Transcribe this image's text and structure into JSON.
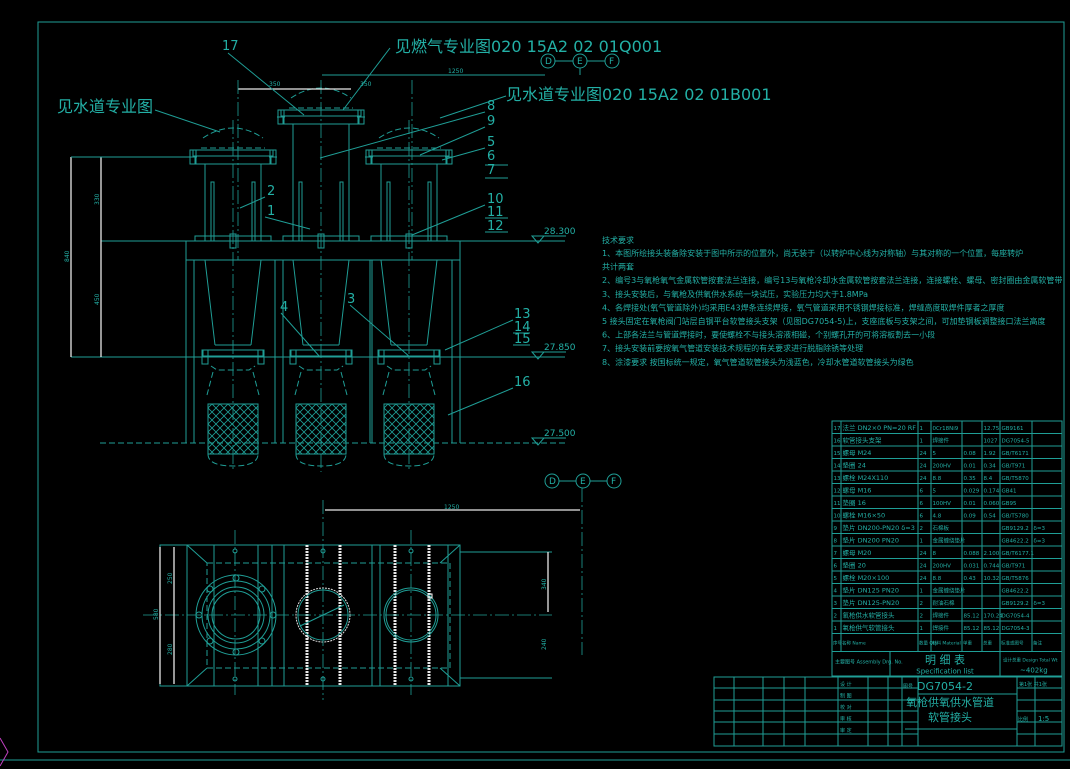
{
  "colors": {
    "line": "#1f9e96",
    "text": "#23b0a6",
    "dimension": "#e8e8e8",
    "background": "#000000"
  },
  "callouts": {
    "gas_ref": "见燃气专业图020 15A2 02 01Q001",
    "water_ref_right": "见水道专业图020 15A2 02 01B001",
    "water_ref_left": "见水道专业图",
    "parts": [
      "17",
      "8",
      "9",
      "5",
      "6",
      "7",
      "10",
      "11",
      "12",
      "2",
      "1",
      "4",
      "3",
      "13",
      "14",
      "15",
      "16"
    ]
  },
  "axes": {
    "top": [
      "D",
      "E",
      "F"
    ],
    "bottom": [
      "D",
      "E",
      "F"
    ]
  },
  "levels": [
    "28.300",
    "27.850",
    "27.500"
  ],
  "dimensions": {
    "d350a": "350",
    "d350b": "350",
    "d1250top": "1250",
    "d330": "330",
    "d840": "840",
    "d450": "450",
    "d1250plan": "1250",
    "d580": "580",
    "d250": "250",
    "d280": "280",
    "d340": "340",
    "d240": "240"
  },
  "notes": {
    "title": "技术要求",
    "items": [
      "1、本图所绘接头装备除安装于图中所示的位置外，尚无装于（以转炉中心线为对称轴）与其对称的一个位置，每座转炉",
      "    共计两套",
      "2、编号3与氧枪氧气金属软管按套法兰连接，编号13与氧枪冷却水金属软管按套法兰连接，连接螺栓、螺母、密封圈由金属软管带",
      "3、接头安装后，与氧枪及供氧供水系统一块试压，实验压力均大于1.8MPa",
      "4、各焊接处(氧气管道除外)均采用E43焊条连续焊接，氧气管道采用不锈钢焊接标准，焊缝高度取焊件厚者之厚度",
      "5  接头固定在氧枪阀门站层自钢平台软管接头支架（见图DG7054-5)上，支座底板与支架之间，可加垫钢板调整接口法兰高度",
      "6、上部各法兰与管道焊接时，要使螺栓不与接头溶液相碰，个别螺孔开的可将溶板割去一小段",
      "7、接头安装前要按氧气管道安装技术规程的有关要求进行脱脂除锈等处理",
      "8、涂漆要求  按国标统一规定，氧气管道软管接头为浅蓝色，冷却水管道软管接头为绿色"
    ]
  },
  "bom": {
    "rows": [
      [
        "17",
        "法兰 DN2×0 PN=20 RF",
        "1",
        "0Cr18Ni9",
        "",
        "12.75",
        "GB9161",
        ""
      ],
      [
        "16",
        "软管接头支架",
        "1",
        "焊接件",
        "",
        "1027",
        "DG7054-5",
        ""
      ],
      [
        "15",
        "螺母 M24",
        "24",
        "5",
        "0.08",
        "1.92",
        "GB/T6171",
        ""
      ],
      [
        "14",
        "垫圈 24",
        "24",
        "200HV",
        "0.01",
        "0.34",
        "GB/T971",
        ""
      ],
      [
        "13",
        "螺栓 M24X110",
        "24",
        "8.8",
        "0.35",
        "8.4",
        "GB/T5870",
        ""
      ],
      [
        "12",
        "螺母 M16",
        "6",
        "5",
        "0.029",
        "0.174",
        "GB41",
        ""
      ],
      [
        "11",
        "垫圈 16",
        "6",
        "100HV",
        "0.01",
        "0.060",
        "GB95",
        ""
      ],
      [
        "10",
        "螺栓 M16×50",
        "6",
        "4.8",
        "0.09",
        "0.54",
        "GB/T5780",
        ""
      ],
      [
        "9",
        "垫片 DN200-PN20 δ=3",
        "2",
        "石棉板",
        "",
        "",
        "GB9129.2",
        "δ=3"
      ],
      [
        "8",
        "垫片 DN200 PN20",
        "1",
        "金属缠绕垫片",
        "",
        "",
        "GB4622.2",
        "δ=3"
      ],
      [
        "7",
        "螺母 M20",
        "24",
        "8",
        "0.088",
        "2.100",
        "GB/T6177.1",
        ""
      ],
      [
        "6",
        "垫圈 20",
        "24",
        "200HV",
        "0.031",
        "0.744",
        "GB/T971",
        ""
      ],
      [
        "5",
        "螺栓 M20×100",
        "24",
        "8.8",
        "0.43",
        "10.32",
        "GB/T5876",
        ""
      ],
      [
        "4",
        "垫片 DN125 PN20",
        "1",
        "金属缠绕垫片",
        "",
        "",
        "GB4622.2",
        ""
      ],
      [
        "3",
        "垫片 DN125-PN20",
        "2",
        "耐油石棉",
        "",
        "",
        "GB9129.2",
        "δ=3"
      ],
      [
        "2",
        "氧枪供水软管接头",
        "2",
        "焊接件",
        "85.12",
        "170.24",
        "DG7054-4",
        ""
      ],
      [
        "1",
        "氧枪供气软管接头",
        "1",
        "焊接件",
        "85.12",
        "85.12",
        "DG7054-3",
        ""
      ]
    ],
    "header": [
      "序号",
      "名称 Name",
      "数量 Qty",
      "材料 Material",
      "单重",
      "总重",
      "标准或图号",
      "备注"
    ],
    "assembly_label": "主要图号 Assembly Drg. No.",
    "title": "明 细 表",
    "subtitle": "Specification list",
    "total_label": "设计总重 Design Total Wt",
    "total_value": "~402kg"
  },
  "title_block": {
    "drawing_no": "DG7054-2",
    "drawing_no_label": "图号",
    "title_line1": "氧枪供氧供水管道",
    "title_line2": "软管接头",
    "sheet": "第1张 共1张",
    "scale_label": "比例",
    "scale": "1:5",
    "roles": [
      "设 计",
      "制 图",
      "校 对",
      "审 核",
      "审 定"
    ]
  }
}
